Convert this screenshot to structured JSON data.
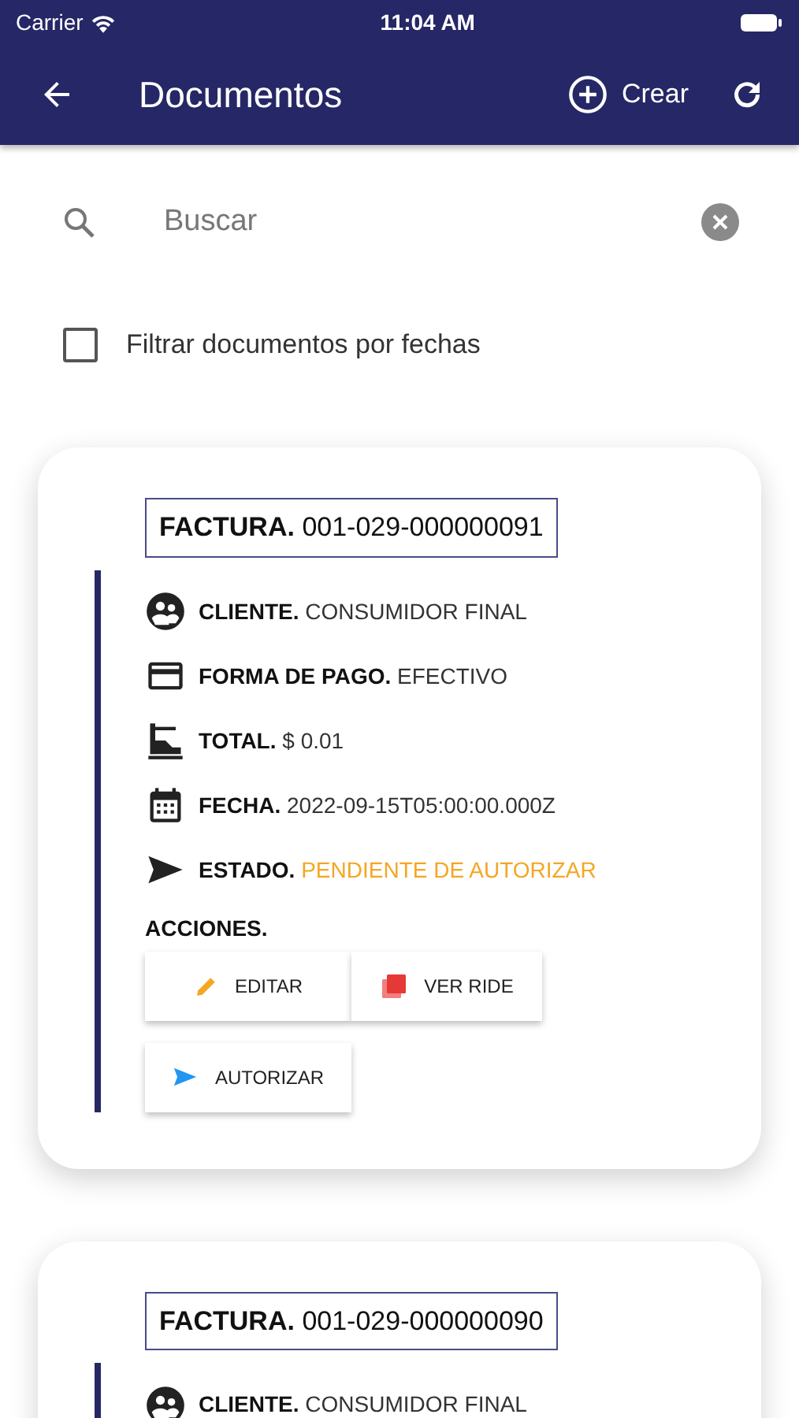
{
  "status_bar": {
    "carrier": "Carrier",
    "time": "11:04 AM"
  },
  "header": {
    "title": "Documentos",
    "create_label": "Crear"
  },
  "search": {
    "placeholder": "Buscar"
  },
  "date_filter": {
    "label": "Filtrar documentos por fechas",
    "checked": false
  },
  "documents": [
    {
      "type_label": "FACTURA.",
      "number": "001-029-000000091",
      "fields": [
        {
          "kind": "client",
          "label": "CLIENTE.",
          "value": "CONSUMIDOR FINAL"
        },
        {
          "kind": "payment",
          "label": "FORMA DE PAGO.",
          "value": "EFECTIVO"
        },
        {
          "kind": "total",
          "label": "TOTAL.",
          "value": "$ 0.01"
        },
        {
          "kind": "date",
          "label": "FECHA.",
          "value": "2022-09-15T05:00:00.000Z"
        },
        {
          "kind": "status",
          "label": "ESTADO.",
          "value": "PENDIENTE DE AUTORIZAR"
        }
      ],
      "actions_label": "ACCIONES.",
      "actions": [
        {
          "kind": "edit",
          "label": "EDITAR"
        },
        {
          "kind": "pdf",
          "label": "VER RIDE"
        },
        {
          "kind": "authorize",
          "label": "AUTORIZAR"
        }
      ]
    },
    {
      "type_label": "FACTURA.",
      "number": "001-029-000000090",
      "fields": [
        {
          "kind": "client",
          "label": "CLIENTE.",
          "value": "CONSUMIDOR FINAL"
        }
      ]
    }
  ]
}
